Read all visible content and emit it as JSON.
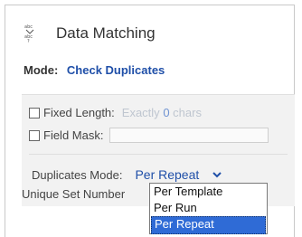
{
  "header": {
    "title": "Data Matching",
    "icon": "data-matching-icon"
  },
  "mode": {
    "label": "Mode:",
    "value": "Check Duplicates"
  },
  "options": {
    "fixed_length": {
      "label": "Fixed Length:",
      "hint_prefix": "Exactly",
      "hint_value": "0",
      "hint_suffix": "chars",
      "checked": false
    },
    "field_mask": {
      "label": "Field Mask:",
      "value": "",
      "checked": false
    },
    "duplicates_mode": {
      "label": "Duplicates Mode:",
      "value": "Per Repeat",
      "options": [
        "Per Template",
        "Per Run",
        "Per Repeat"
      ],
      "selected_index": 2
    },
    "unique_set_number_label": "Unique Set Number"
  },
  "colors": {
    "accent": "#1f4fa8",
    "selection": "#2f6bd6",
    "panel_bg": "#f2f2f2"
  }
}
